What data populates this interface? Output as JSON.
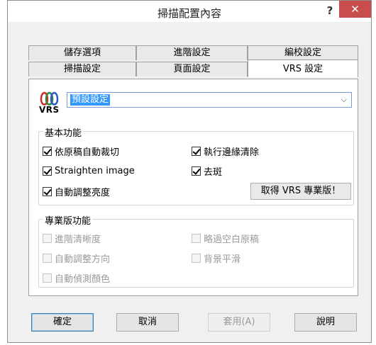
{
  "window": {
    "title": "掃描配置內容",
    "help_label": "?",
    "close_label": "✕"
  },
  "tabs": {
    "row1": [
      "儲存選項",
      "進階設定",
      "編校設定"
    ],
    "row2": [
      "掃描設定",
      "頁面設定",
      "VRS 設定"
    ],
    "active": "VRS 設定"
  },
  "preset": {
    "value": "預設設定",
    "chevron": "chevron-down-icon"
  },
  "logo": {
    "text": "VRS",
    "icon": "vrs-logo-icon"
  },
  "basic": {
    "title": "基本功能",
    "options": [
      {
        "label": "依原稿自動裁切",
        "checked": true
      },
      {
        "label": "執行邊緣清除",
        "checked": true
      },
      {
        "label": "Straighten image",
        "checked": true
      },
      {
        "label": "去斑",
        "checked": true
      },
      {
        "label": "自動調整亮度",
        "checked": true
      }
    ],
    "upgrade_label": "取得 VRS 專業版！"
  },
  "pro": {
    "title": "專業版功能",
    "options": [
      {
        "label": "進階清晰度",
        "checked": false
      },
      {
        "label": "略過空白原稿",
        "checked": false
      },
      {
        "label": "自動調整方向",
        "checked": false
      },
      {
        "label": "背景平滑",
        "checked": false
      },
      {
        "label": "自動偵測顏色",
        "checked": false
      }
    ]
  },
  "buttons": {
    "ok": "確定",
    "cancel": "取消",
    "apply": "套用(A)",
    "help": "說明"
  }
}
